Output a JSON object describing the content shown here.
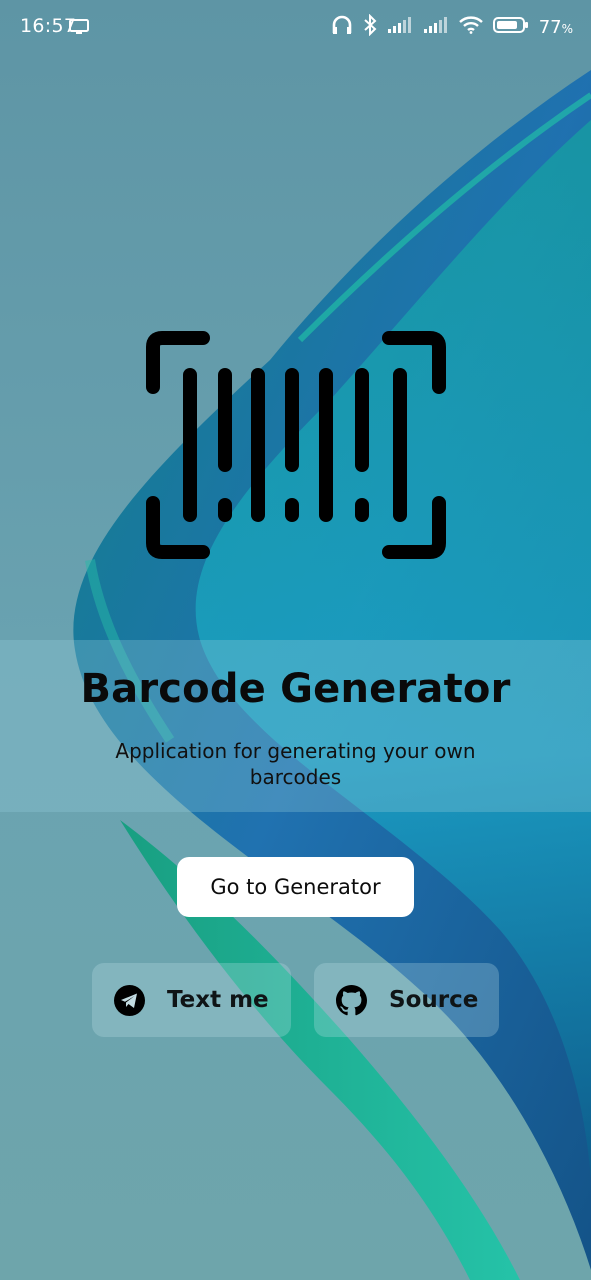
{
  "status_bar": {
    "time": "16:57",
    "battery_percent": "77",
    "battery_unit": "%",
    "icons": [
      "screen-cast-icon",
      "headphones-icon",
      "bluetooth-icon",
      "signal-icon",
      "signal-icon",
      "wifi-icon",
      "battery-icon"
    ]
  },
  "app": {
    "title": "Barcode Generator",
    "subtitle": "Application for generating your own barcodes",
    "logo_icon": "barcode-scan-icon"
  },
  "actions": {
    "primary_label": "Go to Generator",
    "telegram_label": "Text me",
    "telegram_icon": "telegram-icon",
    "source_label": "Source",
    "source_icon": "github-icon"
  },
  "colors": {
    "background": "#5f98a6",
    "primary_button": "#ffffff",
    "text": "#0a0a0a"
  }
}
